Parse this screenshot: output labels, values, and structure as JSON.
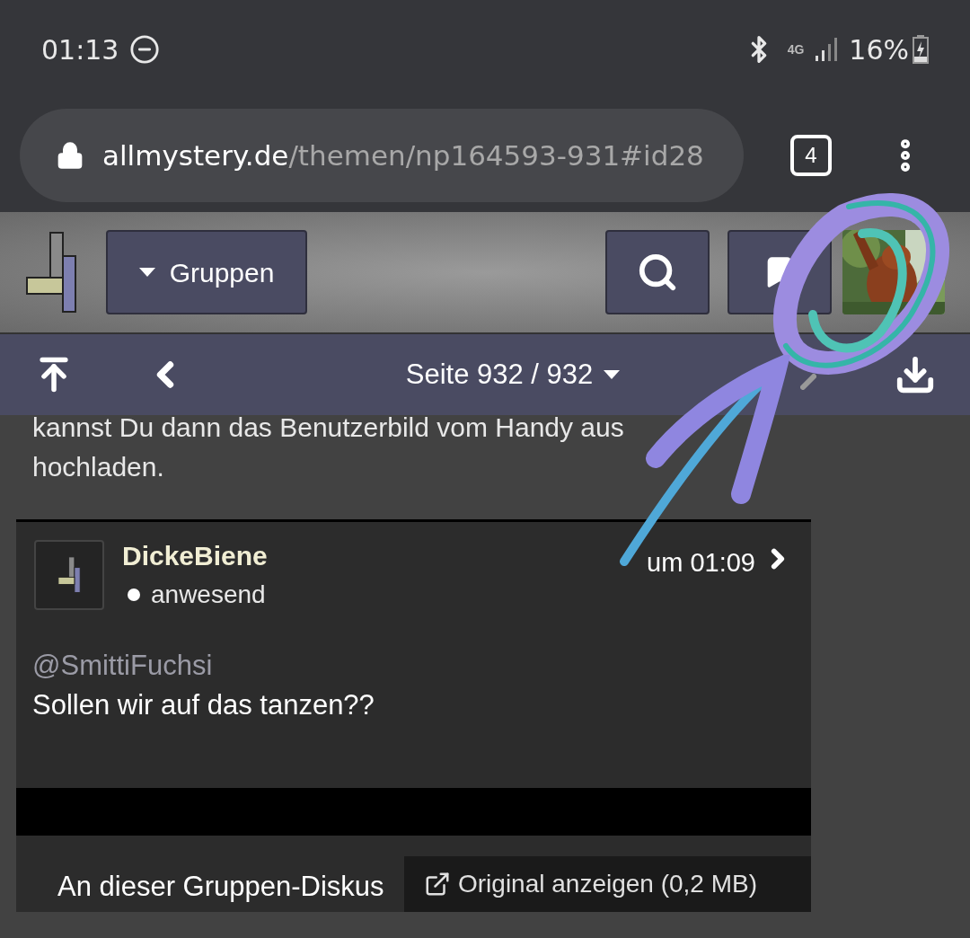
{
  "status_bar": {
    "time": "01:13",
    "network": "4G",
    "battery": "16%"
  },
  "address_bar": {
    "host": "allmystery.de",
    "path": "/themen/np164593-931#id28",
    "tab_count": "4"
  },
  "header": {
    "groups_button": "Gruppen"
  },
  "pager": {
    "label": "Seite 932 / 932"
  },
  "previous_post": {
    "text": "kannst Du dann das Benutzerbild vom Handy aus hochladen."
  },
  "post": {
    "author": "DickeBiene",
    "status": "anwesend",
    "time": "um 01:09",
    "mention": "@SmittiFuchsi",
    "body": "Sollen wir auf das tanzen??"
  },
  "footer": {
    "notice": "An dieser Gruppen-Diskus",
    "image_link": "Original anzeigen (0,2 MB)"
  }
}
